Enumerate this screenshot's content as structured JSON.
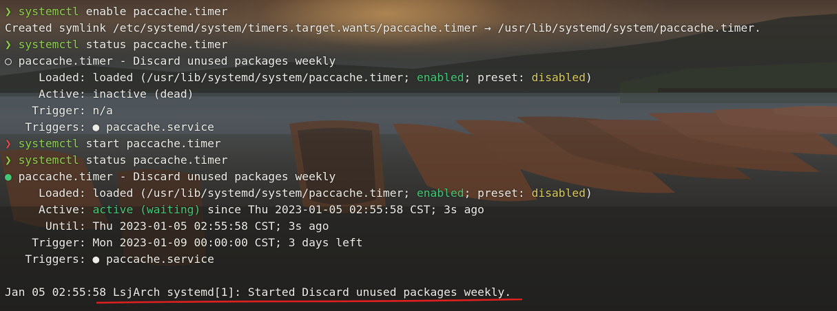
{
  "lines": {
    "l1": {
      "prompt": "❯",
      "cmd": "systemctl",
      "args": " enable paccache.timer"
    },
    "l2": {
      "text": "Created symlink /etc/systemd/system/timers.target.wants/paccache.timer → /usr/lib/systemd/system/paccache.timer."
    },
    "l3": {
      "prompt": "❯",
      "cmd": "systemctl",
      "args": " status paccache.timer"
    },
    "l4": {
      "bullet": "○",
      "text": " paccache.timer - Discard unused packages weekly"
    },
    "l5": {
      "pre": "     Loaded: loaded (/usr/lib/systemd/system/paccache.timer; ",
      "enabled": "enabled",
      "mid": "; preset: ",
      "disabled": "disabled",
      "post": ")"
    },
    "l6": {
      "text": "     Active: inactive (dead)"
    },
    "l7": {
      "text": "    Trigger: n/a"
    },
    "l8": {
      "text": "   Triggers: ● paccache.service"
    },
    "l9": {
      "prompt": "❯",
      "cmd": "systemctl",
      "args": " start paccache.timer"
    },
    "l10": {
      "prompt": "❯",
      "cmd": "systemctl",
      "args": " status paccache.timer"
    },
    "l11": {
      "bullet": "●",
      "text": " paccache.timer - Discard unused packages weekly"
    },
    "l12": {
      "pre": "     Loaded: loaded (/usr/lib/systemd/system/paccache.timer; ",
      "enabled": "enabled",
      "mid": "; preset: ",
      "disabled": "disabled",
      "post": ")"
    },
    "l13": {
      "pre": "     Active: ",
      "active": "active (waiting)",
      "post": " since Thu 2023-01-05 02:55:58 CST; 3s ago"
    },
    "l14": {
      "text": "      Until: Thu 2023-01-05 02:55:58 CST; 3s ago"
    },
    "l15": {
      "text": "    Trigger: Mon 2023-01-09 00:00:00 CST; 3 days left"
    },
    "l16": {
      "text": "   Triggers: ● paccache.service"
    },
    "l17": {
      "text": ""
    },
    "l18": {
      "text": "Jan 05 02:55:58 LsjArch systemd[1]: Started Discard unused packages weekly."
    }
  },
  "colors": {
    "prompt_ok": "#8bd14b",
    "prompt_err": "#e2494a",
    "enabled": "#43c777",
    "disabled": "#d8c860",
    "annotation": "#e0201f"
  }
}
